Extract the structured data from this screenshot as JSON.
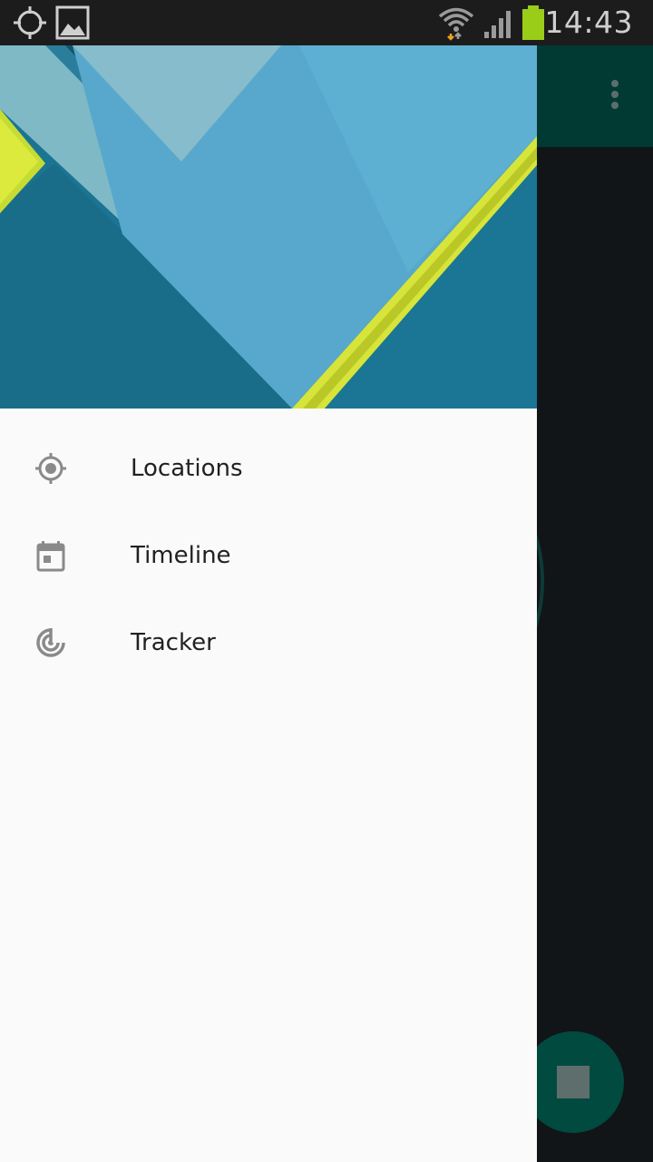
{
  "status_bar": {
    "time": "14:43",
    "icons": [
      "gps-icon",
      "image-notification-icon",
      "wifi-icon",
      "signal-icon",
      "battery-icon"
    ]
  },
  "drawer": {
    "menu_items": [
      {
        "label": "Locations",
        "icon": "gps-fixed-icon"
      },
      {
        "label": "Timeline",
        "icon": "calendar-icon"
      },
      {
        "label": "Tracker",
        "icon": "radar-icon"
      }
    ]
  },
  "app": {
    "toolbar_color": "#003a33",
    "fab_color": "#004a40"
  },
  "colors": {
    "drawer_background": "#fafafa",
    "menu_text": "#212121",
    "menu_icon": "#8a8a8a"
  }
}
